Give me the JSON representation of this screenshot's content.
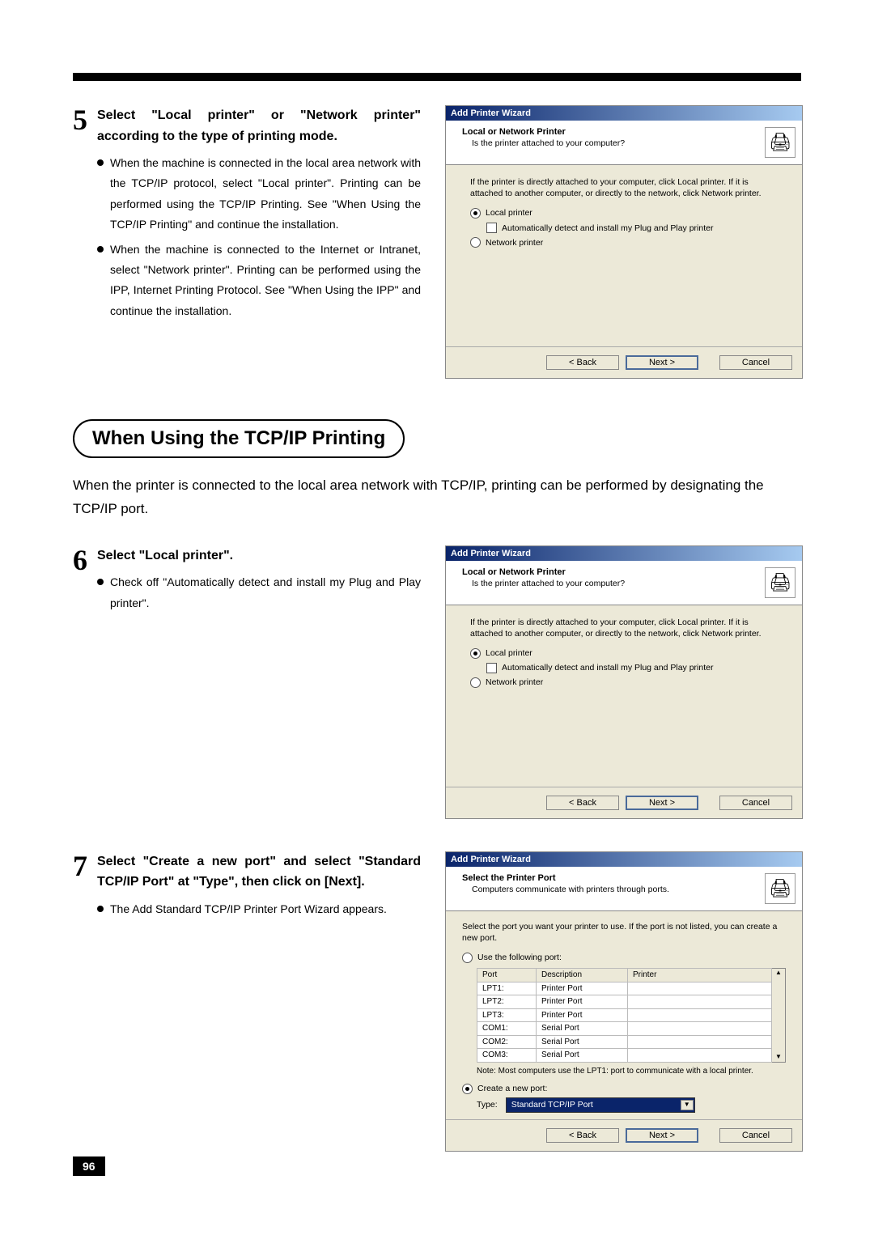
{
  "page_number": "96",
  "steps": {
    "s5": {
      "num": "5",
      "heading": "Select \"Local printer\" or \"Network printer\" according to the type of printing mode.",
      "bullets": [
        "When the machine is connected in the local area network with the TCP/IP protocol, select \"Local printer\".  Printing can be performed using the TCP/IP Printing.  See \"When Using the TCP/IP Printing\" and continue the installation.",
        "When the machine is connected to the Internet or Intranet, select \"Network printer\".  Printing can be performed using the IPP, Internet Printing Protocol.  See \"When Using the IPP\" and continue the installation."
      ]
    },
    "s6": {
      "num": "6",
      "heading": "Select \"Local printer\".",
      "bullets": [
        "Check off \"Automatically detect and install my Plug and Play printer\"."
      ]
    },
    "s7": {
      "num": "7",
      "heading": "Select \"Create a new port\" and select \"Standard TCP/IP Port\" at \"Type\", then click on [Next].",
      "bullets": [
        "The Add Standard TCP/IP Printer Port Wizard appears."
      ]
    }
  },
  "section": {
    "title": "When Using the TCP/IP Printing",
    "intro": "When the printer is connected to the local area network with TCP/IP, printing can be performed by designating the TCP/IP port."
  },
  "wizard_common": {
    "title": "Add Printer Wizard",
    "back": "< Back",
    "next": "Next >",
    "cancel": "Cancel"
  },
  "wizard1": {
    "header_title": "Local or Network Printer",
    "header_sub": "Is the printer attached to your computer?",
    "instr": "If the printer is directly attached to your computer, click Local printer.  If it is attached to another computer, or directly to the network, click Network printer.",
    "opt_local": "Local printer",
    "opt_auto": "Automatically detect and install my Plug and Play printer",
    "opt_network": "Network printer"
  },
  "wizard3": {
    "header_title": "Select the Printer Port",
    "header_sub": "Computers communicate with printers through ports.",
    "instr": "Select the port you want your printer to use.  If the port is not listed, you can create a new port.",
    "opt_use": "Use the following port:",
    "cols": {
      "port": "Port",
      "desc": "Description",
      "printer": "Printer"
    },
    "rows": [
      {
        "port": "LPT1:",
        "desc": "Printer Port"
      },
      {
        "port": "LPT2:",
        "desc": "Printer Port"
      },
      {
        "port": "LPT3:",
        "desc": "Printer Port"
      },
      {
        "port": "COM1:",
        "desc": "Serial Port"
      },
      {
        "port": "COM2:",
        "desc": "Serial Port"
      },
      {
        "port": "COM3:",
        "desc": "Serial Port"
      }
    ],
    "note": "Note: Most computers use the LPT1: port to communicate with a local printer.",
    "opt_create": "Create a new port:",
    "type_label": "Type:",
    "type_value": "Standard TCP/IP Port"
  }
}
